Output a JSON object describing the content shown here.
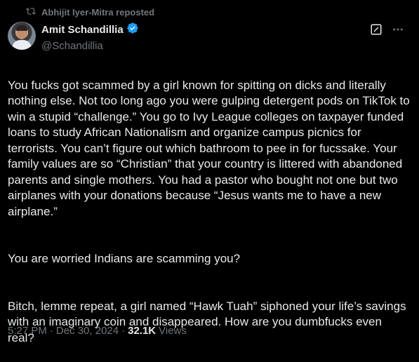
{
  "repost": {
    "text": "Abhijit Iyer-Mitra reposted"
  },
  "author": {
    "display_name": "Amit Schandillia",
    "handle": "@Schandillia"
  },
  "icons": {
    "repost": "repost-icon",
    "verified": "verified-badge-icon",
    "grok": "grok-icon",
    "more": "more-options-icon"
  },
  "colors": {
    "background": "#000000",
    "text": "#e7e9ea",
    "secondary": "#71767b",
    "verified": "#1d9bf0"
  },
  "tweet": {
    "paragraphs": [
      "You fucks got scammed by a girl known for spitting on dicks and literally nothing else. Not too long ago you were gulping detergent pods on TikTok to win a stupid “challenge.” You go to Ivy League colleges on taxpayer funded loans to study African Nationalism and organize campus picnics for terrorists. You can’t figure out which bathroom to pee in for fucssake. Your family values are so “Christian” that your country is littered with abandoned parents and single mothers. You had a pastor who bought not one but two airplanes with your donations because “Jesus wants me to have a new airplane.”",
      "You are worried Indians are scamming you?",
      "Bitch, lemme repeat, a girl named “Hawk Tuah” siphoned your life’s savings with an imaginary coin and disappeared. How are you dumbfucks even real?"
    ]
  },
  "meta": {
    "time": "5:27 PM",
    "dot1": "·",
    "date": "Dec 30, 2024",
    "dot2": "·",
    "views_count": "32.1K",
    "views_label": "Views"
  }
}
